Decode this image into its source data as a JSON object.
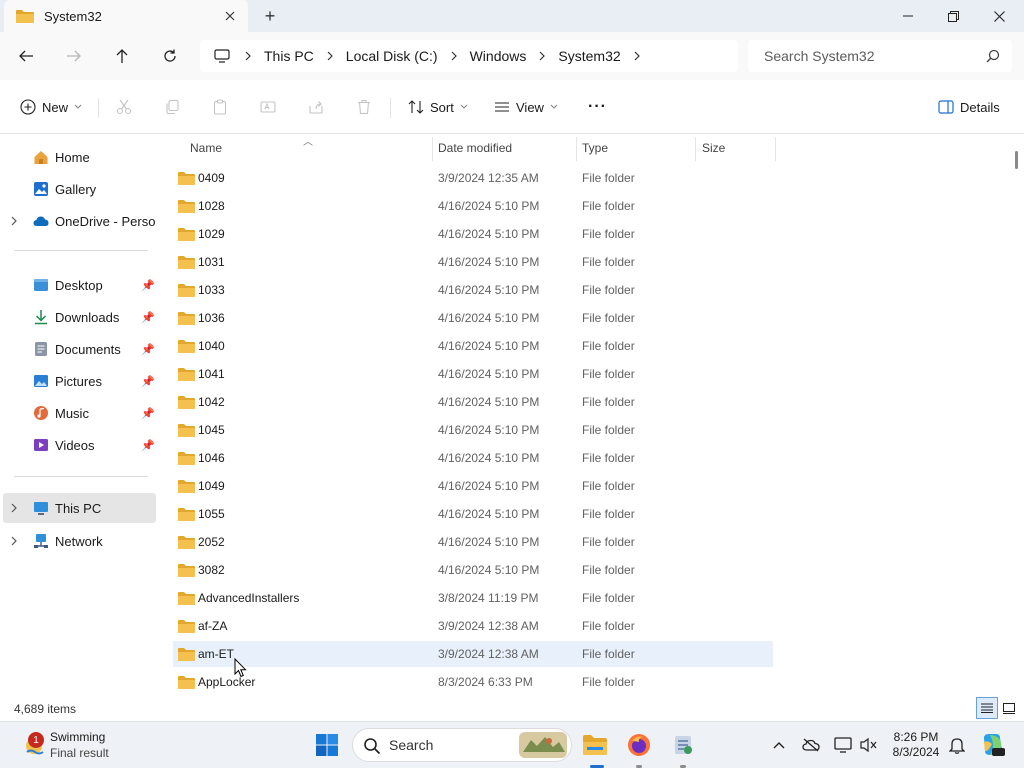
{
  "window": {
    "tab_title": "System32",
    "new_tab": "+"
  },
  "address": {
    "breadcrumbs": [
      "This PC",
      "Local Disk (C:)",
      "Windows",
      "System32"
    ],
    "search_placeholder": "Search System32"
  },
  "commandbar": {
    "new_label": "New",
    "sort_label": "Sort",
    "view_label": "View",
    "more_label": "···",
    "details_label": "Details"
  },
  "sidebar": {
    "home": "Home",
    "gallery": "Gallery",
    "onedrive": "OneDrive - Persona",
    "desktop": "Desktop",
    "downloads": "Downloads",
    "documents": "Documents",
    "pictures": "Pictures",
    "music": "Music",
    "videos": "Videos",
    "this_pc": "This PC",
    "network": "Network"
  },
  "columns": {
    "name": "Name",
    "date": "Date modified",
    "type": "Type",
    "size": "Size"
  },
  "files": [
    {
      "name": "0409",
      "date": "3/9/2024 12:35 AM",
      "type": "File folder"
    },
    {
      "name": "1028",
      "date": "4/16/2024 5:10 PM",
      "type": "File folder"
    },
    {
      "name": "1029",
      "date": "4/16/2024 5:10 PM",
      "type": "File folder"
    },
    {
      "name": "1031",
      "date": "4/16/2024 5:10 PM",
      "type": "File folder"
    },
    {
      "name": "1033",
      "date": "4/16/2024 5:10 PM",
      "type": "File folder"
    },
    {
      "name": "1036",
      "date": "4/16/2024 5:10 PM",
      "type": "File folder"
    },
    {
      "name": "1040",
      "date": "4/16/2024 5:10 PM",
      "type": "File folder"
    },
    {
      "name": "1041",
      "date": "4/16/2024 5:10 PM",
      "type": "File folder"
    },
    {
      "name": "1042",
      "date": "4/16/2024 5:10 PM",
      "type": "File folder"
    },
    {
      "name": "1045",
      "date": "4/16/2024 5:10 PM",
      "type": "File folder"
    },
    {
      "name": "1046",
      "date": "4/16/2024 5:10 PM",
      "type": "File folder"
    },
    {
      "name": "1049",
      "date": "4/16/2024 5:10 PM",
      "type": "File folder"
    },
    {
      "name": "1055",
      "date": "4/16/2024 5:10 PM",
      "type": "File folder"
    },
    {
      "name": "2052",
      "date": "4/16/2024 5:10 PM",
      "type": "File folder"
    },
    {
      "name": "3082",
      "date": "4/16/2024 5:10 PM",
      "type": "File folder"
    },
    {
      "name": "AdvancedInstallers",
      "date": "3/8/2024 11:19 PM",
      "type": "File folder"
    },
    {
      "name": "af-ZA",
      "date": "3/9/2024 12:38 AM",
      "type": "File folder"
    },
    {
      "name": "am-ET",
      "date": "3/9/2024 12:38 AM",
      "type": "File folder"
    },
    {
      "name": "AppLocker",
      "date": "8/3/2024 6:33 PM",
      "type": "File folder"
    }
  ],
  "status": {
    "item_count": "4,689 items"
  },
  "taskbar": {
    "weather_badge": "1",
    "weather_title": "Swimming",
    "weather_sub": "Final result",
    "search_label": "Search",
    "time": "8:26 PM",
    "date": "8/3/2024"
  },
  "colors": {
    "folder": "#f4c04e",
    "folder_dark": "#e3a82b",
    "accent": "#1f6fd1",
    "hover_row": "#e8f1fb"
  }
}
